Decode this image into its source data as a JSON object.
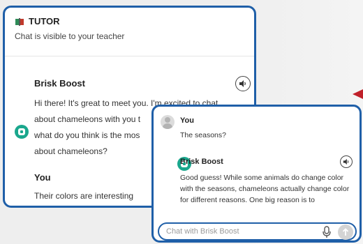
{
  "tutor": {
    "title": "TUTOR",
    "subtitle": "Chat is visible to your teacher"
  },
  "messages_back": [
    {
      "sender": "Brisk Boost",
      "lines": [
        "Hi there! It's great to meet you. I'm excited to chat",
        "about chameleons with you t",
        "what do you think is the mos",
        "about chameleons?"
      ]
    },
    {
      "sender": "You",
      "text": "Their colors are interesting"
    }
  ],
  "messages_front": [
    {
      "sender": "You",
      "text": "The seasons?"
    },
    {
      "sender": "Brisk Boost",
      "lines": [
        "Good guess! While some animals do change color",
        "with the seasons, chameleons actually change color",
        "for different reasons. One big reason is to"
      ]
    }
  ],
  "input": {
    "placeholder": "Chat with Brisk Boost"
  },
  "colors": {
    "accent_border": "#1f5fa8",
    "bot_avatar": "#1aa78d",
    "arrow": "#c0202a"
  },
  "icons": [
    "book-icon",
    "speaker-icon",
    "microphone-icon",
    "send-arrow-icon"
  ]
}
